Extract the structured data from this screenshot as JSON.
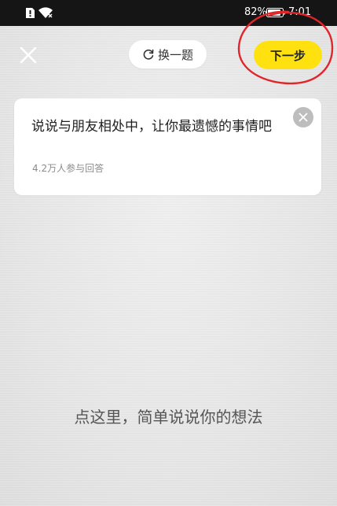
{
  "status_bar": {
    "battery_percent": "82%",
    "time": "7:01",
    "icons": [
      "sim-alert-icon",
      "wifi-icon",
      "battery-icon"
    ]
  },
  "toolbar": {
    "close_icon": "close-icon",
    "switch_label": "换一题",
    "switch_icon": "refresh-icon",
    "next_label": "下一步"
  },
  "question": {
    "text": "说说与朋友相处中，让你最遗憾的事情吧",
    "participants": "4.2万人参与回答",
    "dismiss_icon": "close-icon"
  },
  "editor": {
    "placeholder": "点这里，简单说说你的想法"
  },
  "colors": {
    "accent": "#ffe110",
    "annotation": "#e0262a",
    "status_bar": "#151515"
  }
}
